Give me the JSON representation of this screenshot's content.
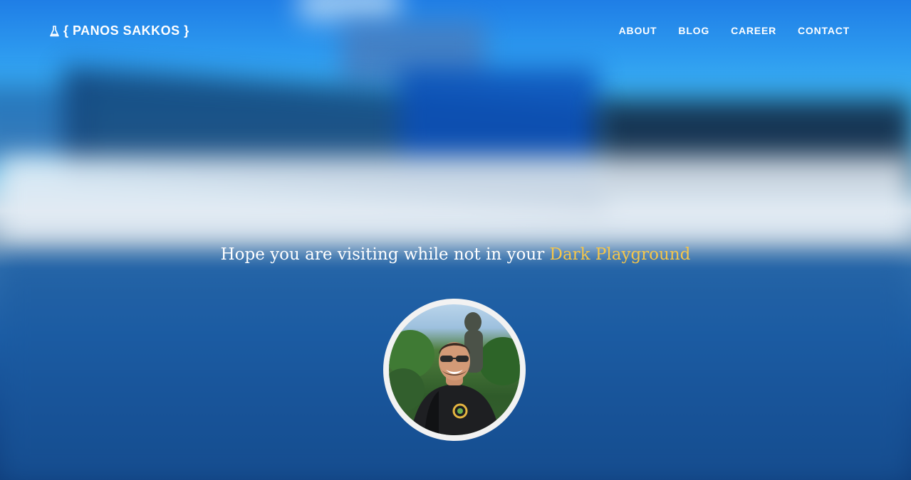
{
  "header": {
    "logo_text": "{ PANOS SAKKOS }",
    "logo_icon": "flask-icon"
  },
  "nav": {
    "items": [
      {
        "label": "ABOUT"
      },
      {
        "label": "BLOG"
      },
      {
        "label": "CAREER"
      },
      {
        "label": "CONTACT"
      }
    ]
  },
  "hero": {
    "tagline_prefix": "Hope you are visiting while not in your ",
    "tagline_accent": "Dark Playground",
    "accent_color": "#f5c64a"
  }
}
